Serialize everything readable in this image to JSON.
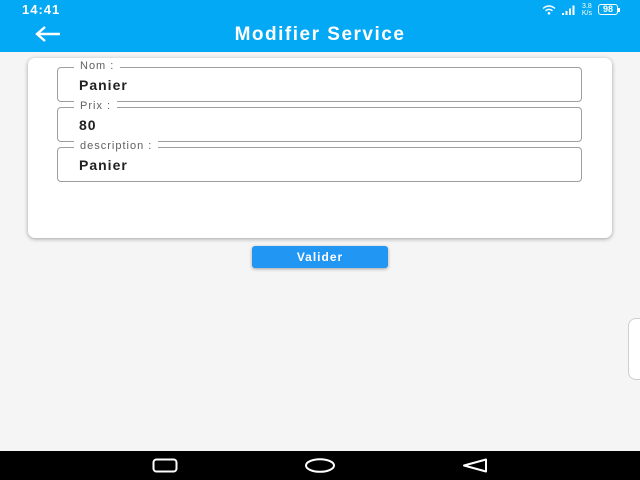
{
  "status_bar": {
    "time": "14:41",
    "net_speed_value": "3.8",
    "net_speed_unit": "K/s",
    "battery": "98",
    "icons": [
      "wifi-icon",
      "signal-icon",
      "battery-icon"
    ]
  },
  "app_bar": {
    "title": "Modifier Service",
    "back_icon": "arrow-left-icon"
  },
  "form": {
    "fields": [
      {
        "label": "Nom :",
        "value": "Panier"
      },
      {
        "label": "Prix :",
        "value": "80"
      },
      {
        "label": "description :",
        "value": "Panier"
      }
    ],
    "submit_label": "Valider"
  },
  "nav_bar": {
    "icons": [
      "recent-apps-icon",
      "home-icon",
      "back-triangle-icon"
    ]
  },
  "colors": {
    "primary": "#03a9f4",
    "button": "#2196f3",
    "background": "#f5f5f5"
  }
}
